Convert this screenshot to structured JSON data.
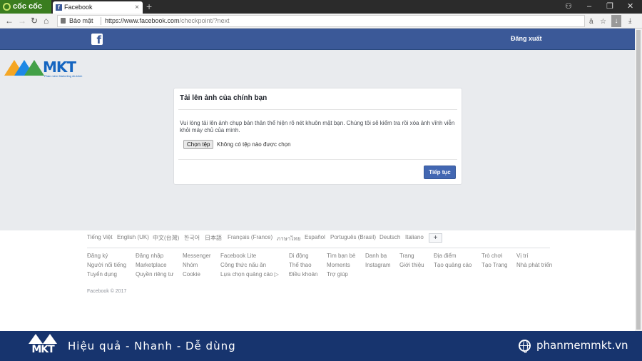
{
  "browser": {
    "brand": "cốc cốc",
    "tab_title": "Facebook",
    "tab_favicon": "f",
    "tab_close": "×",
    "new_tab": "+",
    "secure_label": "Bảo mật",
    "url_base": "https://www.facebook.com",
    "url_path": "/checkpoint/?next",
    "window_controls": [
      "–",
      "❐",
      "✕"
    ]
  },
  "header": {
    "logo_letter": "f",
    "logout_label": "Đăng xuất"
  },
  "watermark_top": {
    "name": "MKT",
    "tagline": "Phần mềm Marketing đa kênh"
  },
  "dialog": {
    "title": "Tải lên ảnh của chính bạn",
    "message": "Vui lòng tải lên ảnh chụp bản thân thể hiện rõ nét khuôn mặt bạn. Chúng tôi sẽ kiểm tra rồi xóa ảnh vĩnh viễn khỏi máy chủ của mình.",
    "choose_file_label": "Chọn tệp",
    "no_file_label": "Không có tệp nào được chọn",
    "continue_label": "Tiếp tục"
  },
  "footer": {
    "languages": [
      "Tiếng Việt",
      "English (UK)",
      "中文(台灣)",
      "한국어",
      "日本語",
      "Français (France)",
      "ภาษาไทย",
      "Español",
      "Português (Brasil)",
      "Deutsch",
      "Italiano"
    ],
    "lang_more": "+",
    "links": [
      [
        "Đăng ký",
        "Người nổi tiếng",
        "Tuyển dụng"
      ],
      [
        "Đăng nhập",
        "Marketplace",
        "Quyền riêng tư"
      ],
      [
        "Messenger",
        "Nhóm",
        "Cookie"
      ],
      [
        "Facebook Lite",
        "Công thức nấu ăn",
        "Lựa chọn quảng cáo ▷"
      ],
      [
        "Di động",
        "Thể thao",
        "Điều khoản"
      ],
      [
        "Tìm bạn bè",
        "Moments",
        "Trợ giúp"
      ],
      [
        "Danh bạ",
        "Instagram",
        ""
      ],
      [
        "Trang",
        "Giới thiệu",
        ""
      ],
      [
        "Địa điểm",
        "Tạo quảng cáo",
        ""
      ],
      [
        "Trò chơi",
        "Tạo Trang",
        ""
      ],
      [
        "Vị trí",
        "Nhà phát triển",
        ""
      ]
    ],
    "copyright": "Facebook © 2017"
  },
  "banner": {
    "logo_text": "MKT",
    "slogan": "Hiệu quả - Nhanh - Dễ dùng",
    "website": "phanmemmkt.vn"
  }
}
